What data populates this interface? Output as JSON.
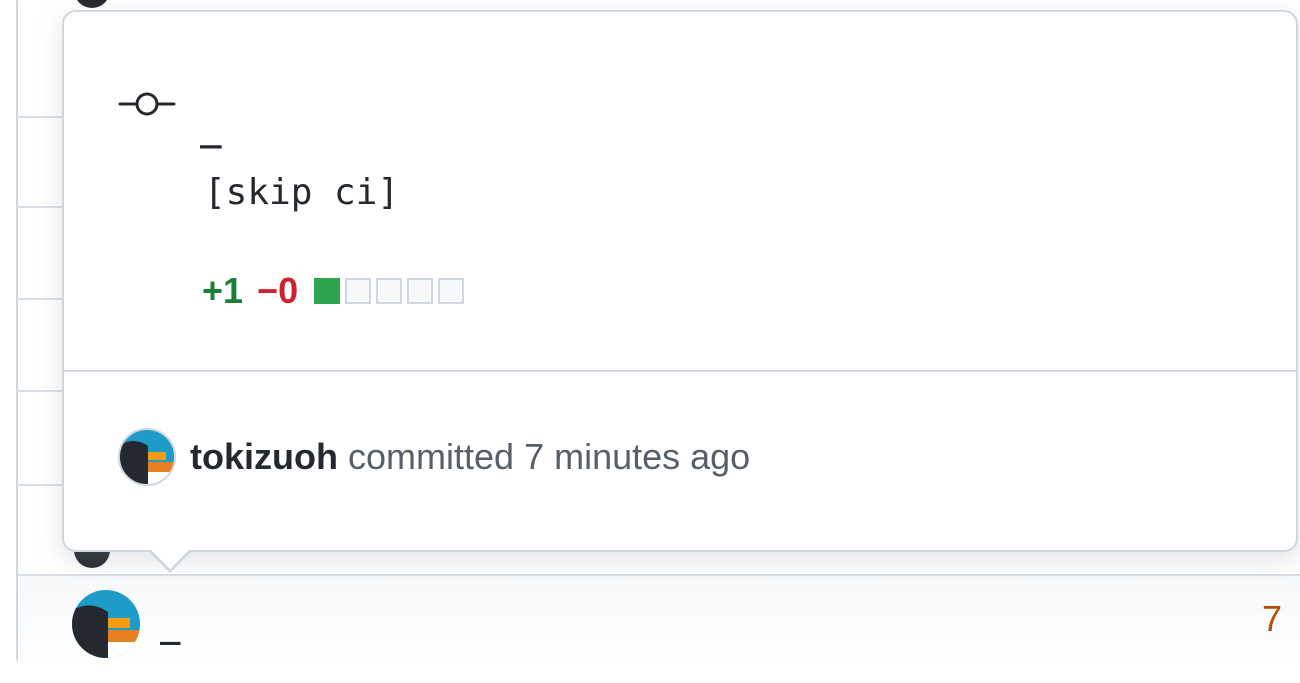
{
  "hovercard": {
    "commit_title": "_",
    "commit_body": "[skip ci]",
    "additions": "+1",
    "deletions": "−0",
    "diff_blocks": {
      "added": 1,
      "total": 5
    },
    "author": {
      "name": "tokizuoh",
      "action": "committed",
      "time": "7 minutes ago"
    }
  },
  "list_row": {
    "title": "_",
    "count": "7"
  },
  "icons": {
    "commit": "git-commit-icon",
    "avatar": "avatar-icon"
  },
  "colors": {
    "additions": "#1a7f37",
    "deletions": "#cf222e",
    "diff_added": "#2da44e",
    "count": "#bc4c00",
    "avatar_bg": "#1f9bc7",
    "avatar_dark": "#24292f",
    "avatar_orange": "#f39c12"
  }
}
